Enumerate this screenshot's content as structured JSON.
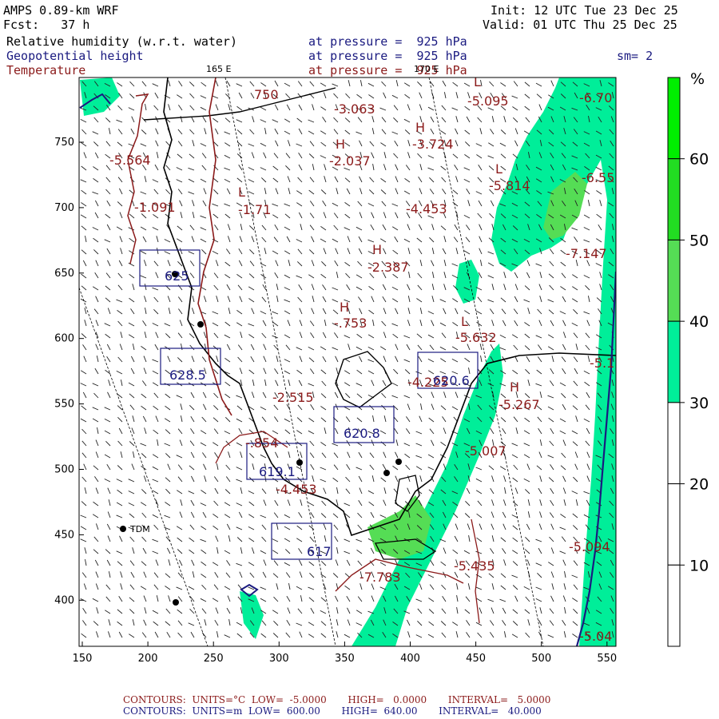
{
  "header": {
    "model": "AMPS 0.89-km WRF",
    "forecast": "Fcst:   37 h",
    "init": "Init: 12 UTC Tue 23 Dec 25",
    "valid": "Valid: 01 UTC Thu 25 Dec 25",
    "field1_name": "Relative humidity (w.r.t. water)",
    "field1_level": "at pressure =  925 hPa",
    "field2_name": "Geopotential height",
    "field2_level": "at pressure =  925 hPa",
    "field3_name": "Temperature",
    "field3_level": "at pressure =  925 hPa",
    "smoothing": "sm= 2"
  },
  "map": {
    "x_ticks": [
      "150",
      "200",
      "250",
      "300",
      "350",
      "400",
      "450",
      "500",
      "550"
    ],
    "y_ticks": [
      "750",
      "700",
      "650",
      "600",
      "550",
      "500",
      "450",
      "400"
    ],
    "lon_labels": [
      "165 E",
      "170 E"
    ],
    "station_label": "TDM",
    "colors": {
      "rh_30_40": "#00ee99",
      "rh_40_50": "#55dd55",
      "rh_50_60": "#22dd22",
      "rh_60_plus": "#00ee00",
      "temperature_contour": "#8b1a1a",
      "height_contour": "#1a1a80",
      "coastline": "#000000"
    },
    "temperature_labels": [
      "-3.063",
      "-5.095",
      "-6.70",
      "-3.724",
      "-2.037",
      "-5.814",
      "-6.55",
      "-4.453",
      "-1.71",
      "-1.091",
      "-5.564",
      "-2.387",
      "-7.147",
      "-.753",
      "-5.632",
      "-5.1",
      "-2.515",
      "-5.267",
      "-4.453",
      "-5.007",
      "-.854",
      "-4.225",
      "-5.435",
      "-7.783",
      "-5.094",
      "-5.04",
      "750"
    ],
    "pressure_extrema": [
      "H",
      "H",
      "H",
      "H",
      "H",
      "L",
      "L",
      "L",
      "L"
    ],
    "height_labels": [
      "625",
      "628.5",
      "620.8",
      "619.1",
      "617",
      "620.6"
    ]
  },
  "colorbar": {
    "unit": "%",
    "ticks": [
      "60",
      "50",
      "40",
      "30",
      "20",
      "10"
    ],
    "bins": [
      {
        "range": "60+",
        "color": "#00ee00"
      },
      {
        "range": "50-60",
        "color": "#22dd22"
      },
      {
        "range": "40-50",
        "color": "#55dd55"
      },
      {
        "range": "30-40",
        "color": "#00ee99"
      },
      {
        "range": "20-30",
        "color": "#ffffff"
      },
      {
        "range": "10-20",
        "color": "#ffffff"
      },
      {
        "range": "0-10",
        "color": "#ffffff"
      }
    ]
  },
  "footer": {
    "temp_line": "CONTOURS:  UNITS=°C  LOW=  -5.0000       HIGH=   0.0000       INTERVAL=   5.0000",
    "height_line": "CONTOURS:  UNITS=m  LOW=  600.00       HIGH=  640.00       INTERVAL=   40.000"
  }
}
